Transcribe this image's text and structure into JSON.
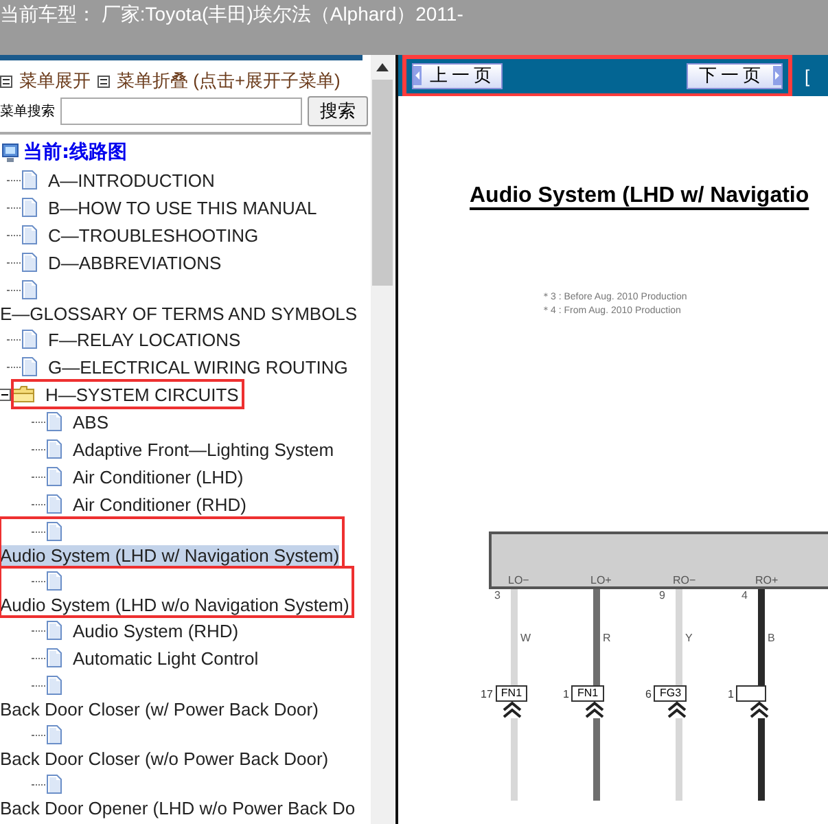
{
  "header": {
    "title": "当前车型： 厂家:Toyota(丰田)埃尔法（Alphard）2011-"
  },
  "menu_controls": [
    {
      "label": "菜单展开"
    },
    {
      "label": "菜单折叠 (点击+展开子菜单)"
    }
  ],
  "search": {
    "label": "菜单搜索",
    "button": "搜索"
  },
  "tree": {
    "label": "当前:线路图",
    "children": [
      {
        "label": "A—INTRODUCTION",
        "kind": "doc",
        "wrapped": false
      },
      {
        "label": "B—HOW TO USE THIS MANUAL",
        "kind": "doc",
        "wrapped": false
      },
      {
        "label": "C—TROUBLESHOOTING",
        "kind": "doc",
        "wrapped": false
      },
      {
        "label": "D—ABBREVIATIONS",
        "kind": "doc",
        "wrapped": false
      },
      {
        "label": "E—GLOSSARY OF TERMS AND SYMBOLS",
        "kind": "doc",
        "wrapped": true
      },
      {
        "label": "F—RELAY LOCATIONS",
        "kind": "doc",
        "wrapped": false
      },
      {
        "label": "G—ELECTRICAL WIRING ROUTING",
        "kind": "doc",
        "wrapped": false
      },
      {
        "label": "H—SYSTEM CIRCUITS",
        "kind": "folder",
        "expanded": true,
        "highlighted": true,
        "children": [
          {
            "label": "ABS",
            "kind": "doc",
            "wrapped": false
          },
          {
            "label": "Adaptive Front—Lighting System",
            "kind": "doc",
            "wrapped": false
          },
          {
            "label": "Air Conditioner (LHD)",
            "kind": "doc",
            "wrapped": false
          },
          {
            "label": "Air Conditioner (RHD)",
            "kind": "doc",
            "wrapped": false
          },
          {
            "label": "Audio System (LHD w/ Navigation System)",
            "kind": "doc",
            "wrapped": true,
            "selected": true,
            "highlighted": true
          },
          {
            "label": "Audio System (LHD w/o Navigation System)",
            "kind": "doc",
            "wrapped": true,
            "highlighted": true
          },
          {
            "label": "Audio System (RHD)",
            "kind": "doc",
            "wrapped": false
          },
          {
            "label": "Automatic Light Control",
            "kind": "doc",
            "wrapped": false
          },
          {
            "label": "Back Door Closer (w/ Power Back Door)",
            "kind": "doc",
            "wrapped": true
          },
          {
            "label": "Back Door Closer (w/o Power Back Door)",
            "kind": "doc",
            "wrapped": true
          },
          {
            "label": "Back Door Opener (LHD w/o Power Back Do",
            "kind": "doc",
            "wrapped": true
          }
        ]
      }
    ]
  },
  "nav": {
    "highlighted": true,
    "prev": "上一页",
    "next": "下一页",
    "edge": "["
  },
  "document": {
    "title": "Audio System (LHD w/ Navigatio",
    "notes": [
      "＊3 : Before Aug.  2010 Production",
      "＊4 : From Aug.  2010 Production"
    ],
    "pins": [
      {
        "label": "LO−",
        "number": "3",
        "wire": "W",
        "connector": "FN1",
        "connector_pin": "17",
        "color": "#d8d8d8"
      },
      {
        "label": "LO+",
        "wire": "R",
        "connector": "FN1",
        "connector_pin": "1",
        "color": "#6e6e6e"
      },
      {
        "label": "RO−",
        "number": "9",
        "wire": "Y",
        "connector": "FG3",
        "connector_pin": "6",
        "color": "#d8d8d8"
      },
      {
        "label": "RO+",
        "number": "4",
        "wire": "B",
        "connector_pin": "1",
        "color": "#2a2a2a"
      }
    ]
  }
}
